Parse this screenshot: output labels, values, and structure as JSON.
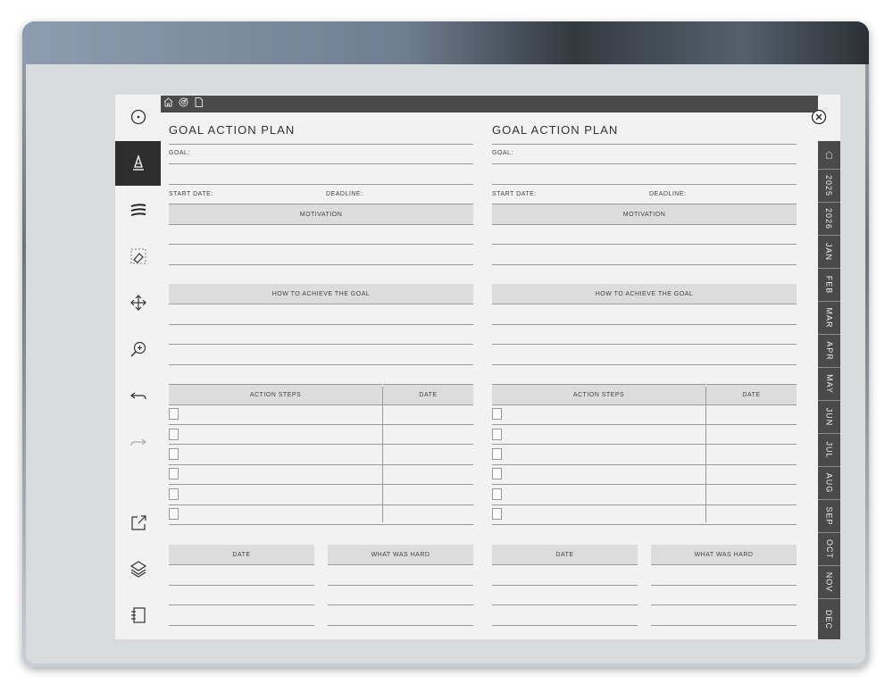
{
  "topbar": {
    "icons": [
      "home-icon",
      "target-icon",
      "page-icon"
    ]
  },
  "toolbar": {
    "tools": [
      "pen-menu-icon",
      "marker-icon",
      "line-weight-icon",
      "eraser-icon",
      "move-icon",
      "zoom-in-icon",
      "undo-icon",
      "redo-icon",
      "export-icon",
      "layers-icon",
      "notebook-icon"
    ]
  },
  "pages": [
    {
      "title": "GOAL ACTION PLAN",
      "goal_label": "GOAL:",
      "start_date_label": "START DATE:",
      "deadline_label": "DEADLINE:",
      "motivation_header": "MOTIVATION",
      "how_header": "HOW TO ACHIEVE THE GOAL",
      "action_steps_header": "ACTION STEPS",
      "action_date_header": "DATE",
      "bottom_date_header": "DATE",
      "hard_header": "WHAT WAS HARD"
    },
    {
      "title": "GOAL ACTION PLAN",
      "goal_label": "GOAL:",
      "start_date_label": "START DATE:",
      "deadline_label": "DEADLINE:",
      "motivation_header": "MOTIVATION",
      "how_header": "HOW TO ACHIEVE THE GOAL",
      "action_steps_header": "ACTION STEPS",
      "action_date_header": "DATE",
      "bottom_date_header": "DATE",
      "hard_header": "WHAT WAS HARD"
    }
  ],
  "tabs": [
    "2025",
    "2026",
    "JAN",
    "FEB",
    "MAR",
    "APR",
    "MAY",
    "JUN",
    "JUL",
    "AUG",
    "SEP",
    "OCT",
    "NOV",
    "DEC"
  ],
  "tab_home_icon": "home-icon"
}
